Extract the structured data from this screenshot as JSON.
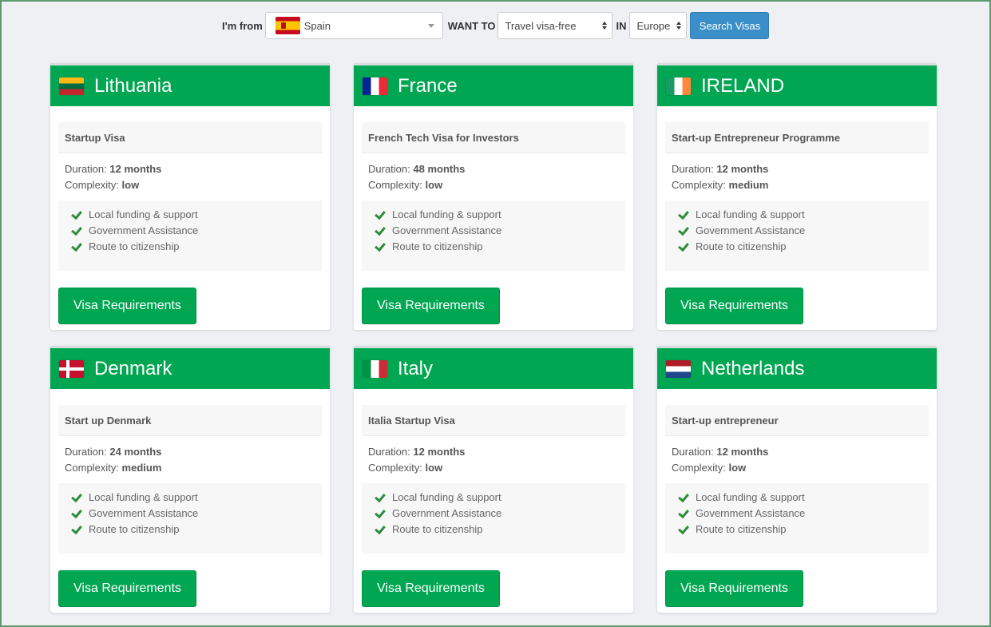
{
  "search": {
    "from_label": "I'm from",
    "from_country": "Spain",
    "want_label": "WANT TO",
    "want_value": "Travel visa-free",
    "in_label": "IN",
    "region_value": "Europe",
    "button_label": "Search Visas"
  },
  "colors": {
    "accent_green": "#00a651",
    "search_blue": "#3b8fc9"
  },
  "cards": [
    {
      "country": "Lithuania",
      "flag_icon": "lithuania-flag-icon",
      "program": "Startup Visa",
      "duration_label": "Duration:",
      "duration": "12 months",
      "complexity_label": "Complexity:",
      "complexity": "low",
      "features": [
        "Local funding & support",
        "Government Assistance",
        "Route to citizenship"
      ],
      "button": "Visa Requirements"
    },
    {
      "country": "France",
      "flag_icon": "france-flag-icon",
      "program": "French Tech Visa for Investors",
      "duration_label": "Duration:",
      "duration": "48 months",
      "complexity_label": "Complexity:",
      "complexity": "low",
      "features": [
        "Local funding & support",
        "Government Assistance",
        "Route to citizenship"
      ],
      "button": "Visa Requirements"
    },
    {
      "country": "IRELAND",
      "flag_icon": "ireland-flag-icon",
      "program": "Start-up Entrepreneur Programme",
      "duration_label": "Duration:",
      "duration": "12 months",
      "complexity_label": "Complexity:",
      "complexity": "medium",
      "features": [
        "Local funding & support",
        "Government Assistance",
        "Route to citizenship"
      ],
      "button": "Visa Requirements"
    },
    {
      "country": "Denmark",
      "flag_icon": "denmark-flag-icon",
      "program": "Start up Denmark",
      "duration_label": "Duration:",
      "duration": "24 months",
      "complexity_label": "Complexity:",
      "complexity": "medium",
      "features": [
        "Local funding & support",
        "Government Assistance",
        "Route to citizenship"
      ],
      "button": "Visa Requirements"
    },
    {
      "country": "Italy",
      "flag_icon": "italy-flag-icon",
      "program": "Italia Startup Visa",
      "duration_label": "Duration:",
      "duration": "12 months",
      "complexity_label": "Complexity:",
      "complexity": "low",
      "features": [
        "Local funding & support",
        "Government Assistance",
        "Route to citizenship"
      ],
      "button": "Visa Requirements"
    },
    {
      "country": "Netherlands",
      "flag_icon": "netherlands-flag-icon",
      "program": "Start-up entrepreneur",
      "duration_label": "Duration:",
      "duration": "12 months",
      "complexity_label": "Complexity:",
      "complexity": "low",
      "features": [
        "Local funding & support",
        "Government Assistance",
        "Route to citizenship"
      ],
      "button": "Visa Requirements"
    }
  ]
}
